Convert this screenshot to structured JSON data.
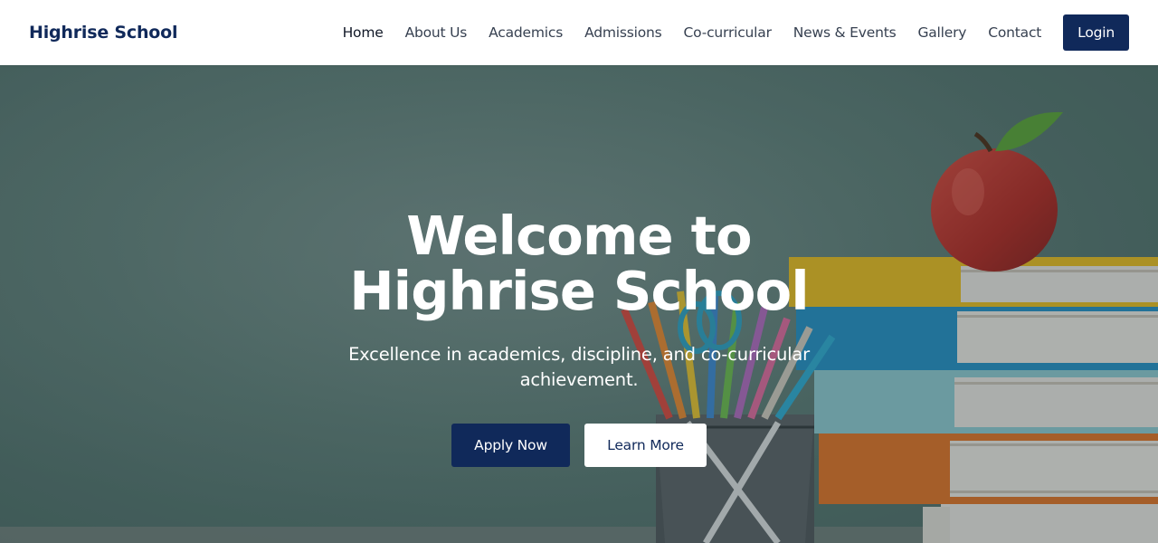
{
  "brand": {
    "name": "Highrise School"
  },
  "nav": {
    "items": [
      {
        "label": "Home"
      },
      {
        "label": "About Us"
      },
      {
        "label": "Academics"
      },
      {
        "label": "Admissions"
      },
      {
        "label": "Co-curricular"
      },
      {
        "label": "News & Events"
      },
      {
        "label": "Gallery"
      },
      {
        "label": "Contact"
      }
    ],
    "login_label": "Login"
  },
  "hero": {
    "title": "Welcome to Highrise School",
    "subtitle": "Excellence in academics, discipline, and co-curricular achievement.",
    "primary_button": "Apply Now",
    "secondary_button": "Learn More"
  },
  "colors": {
    "brand_navy": "#10295a",
    "nav_text": "#374151",
    "hero_board_green": "#587a72",
    "white": "#ffffff"
  },
  "icons": [
    "apple-illustration",
    "books-stack-illustration",
    "pencil-cup-illustration"
  ]
}
